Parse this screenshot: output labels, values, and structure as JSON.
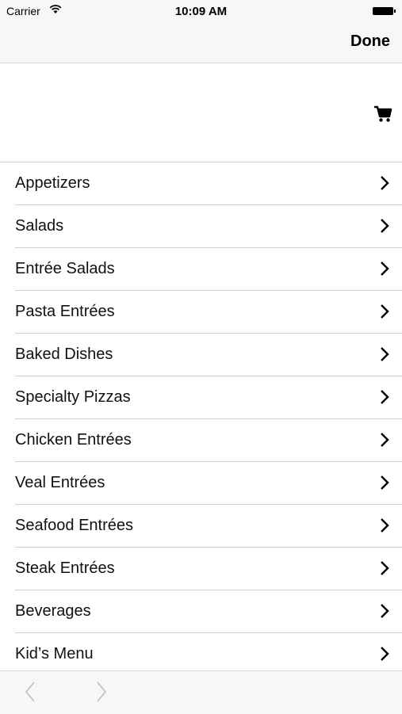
{
  "status_bar": {
    "carrier": "Carrier",
    "time": "10:09 AM"
  },
  "nav": {
    "done_label": "Done"
  },
  "menu": {
    "items": [
      {
        "label": "Appetizers"
      },
      {
        "label": "Salads"
      },
      {
        "label": "Entrée Salads"
      },
      {
        "label": "Pasta Entrées"
      },
      {
        "label": "Baked Dishes"
      },
      {
        "label": "Specialty Pizzas"
      },
      {
        "label": "Chicken Entrées"
      },
      {
        "label": "Veal Entrées"
      },
      {
        "label": "Seafood Entrées"
      },
      {
        "label": "Steak Entrées"
      },
      {
        "label": "Beverages"
      },
      {
        "label": "Kid’s Menu"
      }
    ]
  },
  "icons": {
    "wifi": "wifi-icon",
    "battery": "battery-icon",
    "cart": "cart-icon",
    "chevron": "chevron-right-icon",
    "back": "back-arrow-icon",
    "forward": "forward-arrow-icon"
  },
  "colors": {
    "bar_background": "#f7f7f7",
    "separator": "#cfcfcf",
    "disabled_arrow": "#c7c7cc"
  }
}
